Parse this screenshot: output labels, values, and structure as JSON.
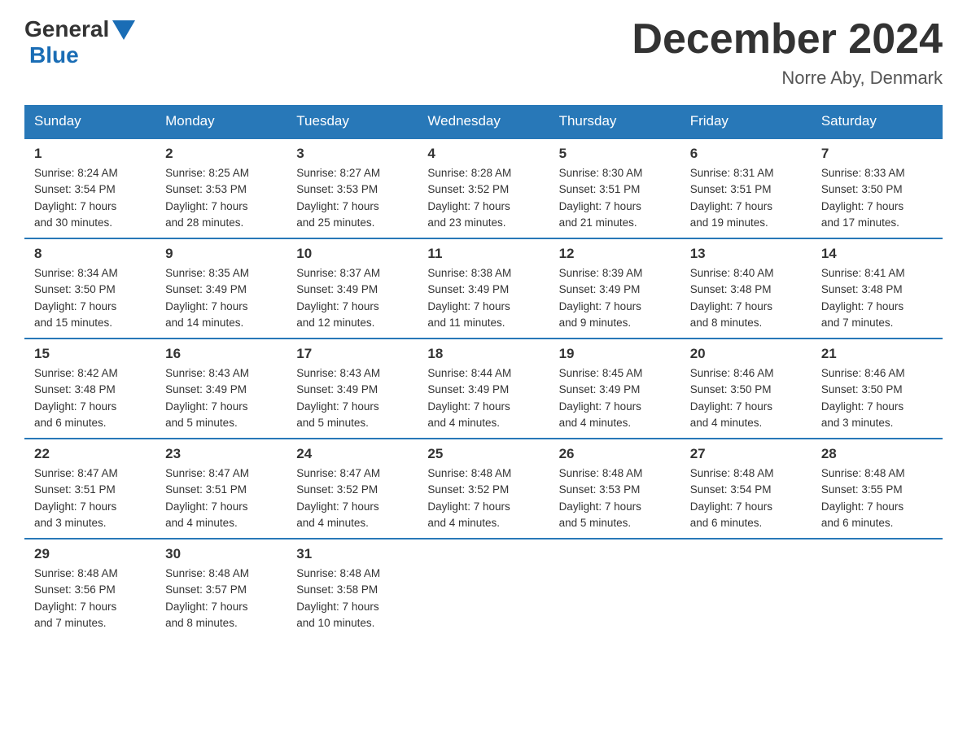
{
  "header": {
    "logo_general": "General",
    "logo_blue": "Blue",
    "title": "December 2024",
    "subtitle": "Norre Aby, Denmark"
  },
  "weekdays": [
    "Sunday",
    "Monday",
    "Tuesday",
    "Wednesday",
    "Thursday",
    "Friday",
    "Saturday"
  ],
  "weeks": [
    [
      {
        "day": "1",
        "info": "Sunrise: 8:24 AM\nSunset: 3:54 PM\nDaylight: 7 hours\nand 30 minutes."
      },
      {
        "day": "2",
        "info": "Sunrise: 8:25 AM\nSunset: 3:53 PM\nDaylight: 7 hours\nand 28 minutes."
      },
      {
        "day": "3",
        "info": "Sunrise: 8:27 AM\nSunset: 3:53 PM\nDaylight: 7 hours\nand 25 minutes."
      },
      {
        "day": "4",
        "info": "Sunrise: 8:28 AM\nSunset: 3:52 PM\nDaylight: 7 hours\nand 23 minutes."
      },
      {
        "day": "5",
        "info": "Sunrise: 8:30 AM\nSunset: 3:51 PM\nDaylight: 7 hours\nand 21 minutes."
      },
      {
        "day": "6",
        "info": "Sunrise: 8:31 AM\nSunset: 3:51 PM\nDaylight: 7 hours\nand 19 minutes."
      },
      {
        "day": "7",
        "info": "Sunrise: 8:33 AM\nSunset: 3:50 PM\nDaylight: 7 hours\nand 17 minutes."
      }
    ],
    [
      {
        "day": "8",
        "info": "Sunrise: 8:34 AM\nSunset: 3:50 PM\nDaylight: 7 hours\nand 15 minutes."
      },
      {
        "day": "9",
        "info": "Sunrise: 8:35 AM\nSunset: 3:49 PM\nDaylight: 7 hours\nand 14 minutes."
      },
      {
        "day": "10",
        "info": "Sunrise: 8:37 AM\nSunset: 3:49 PM\nDaylight: 7 hours\nand 12 minutes."
      },
      {
        "day": "11",
        "info": "Sunrise: 8:38 AM\nSunset: 3:49 PM\nDaylight: 7 hours\nand 11 minutes."
      },
      {
        "day": "12",
        "info": "Sunrise: 8:39 AM\nSunset: 3:49 PM\nDaylight: 7 hours\nand 9 minutes."
      },
      {
        "day": "13",
        "info": "Sunrise: 8:40 AM\nSunset: 3:48 PM\nDaylight: 7 hours\nand 8 minutes."
      },
      {
        "day": "14",
        "info": "Sunrise: 8:41 AM\nSunset: 3:48 PM\nDaylight: 7 hours\nand 7 minutes."
      }
    ],
    [
      {
        "day": "15",
        "info": "Sunrise: 8:42 AM\nSunset: 3:48 PM\nDaylight: 7 hours\nand 6 minutes."
      },
      {
        "day": "16",
        "info": "Sunrise: 8:43 AM\nSunset: 3:49 PM\nDaylight: 7 hours\nand 5 minutes."
      },
      {
        "day": "17",
        "info": "Sunrise: 8:43 AM\nSunset: 3:49 PM\nDaylight: 7 hours\nand 5 minutes."
      },
      {
        "day": "18",
        "info": "Sunrise: 8:44 AM\nSunset: 3:49 PM\nDaylight: 7 hours\nand 4 minutes."
      },
      {
        "day": "19",
        "info": "Sunrise: 8:45 AM\nSunset: 3:49 PM\nDaylight: 7 hours\nand 4 minutes."
      },
      {
        "day": "20",
        "info": "Sunrise: 8:46 AM\nSunset: 3:50 PM\nDaylight: 7 hours\nand 4 minutes."
      },
      {
        "day": "21",
        "info": "Sunrise: 8:46 AM\nSunset: 3:50 PM\nDaylight: 7 hours\nand 3 minutes."
      }
    ],
    [
      {
        "day": "22",
        "info": "Sunrise: 8:47 AM\nSunset: 3:51 PM\nDaylight: 7 hours\nand 3 minutes."
      },
      {
        "day": "23",
        "info": "Sunrise: 8:47 AM\nSunset: 3:51 PM\nDaylight: 7 hours\nand 4 minutes."
      },
      {
        "day": "24",
        "info": "Sunrise: 8:47 AM\nSunset: 3:52 PM\nDaylight: 7 hours\nand 4 minutes."
      },
      {
        "day": "25",
        "info": "Sunrise: 8:48 AM\nSunset: 3:52 PM\nDaylight: 7 hours\nand 4 minutes."
      },
      {
        "day": "26",
        "info": "Sunrise: 8:48 AM\nSunset: 3:53 PM\nDaylight: 7 hours\nand 5 minutes."
      },
      {
        "day": "27",
        "info": "Sunrise: 8:48 AM\nSunset: 3:54 PM\nDaylight: 7 hours\nand 6 minutes."
      },
      {
        "day": "28",
        "info": "Sunrise: 8:48 AM\nSunset: 3:55 PM\nDaylight: 7 hours\nand 6 minutes."
      }
    ],
    [
      {
        "day": "29",
        "info": "Sunrise: 8:48 AM\nSunset: 3:56 PM\nDaylight: 7 hours\nand 7 minutes."
      },
      {
        "day": "30",
        "info": "Sunrise: 8:48 AM\nSunset: 3:57 PM\nDaylight: 7 hours\nand 8 minutes."
      },
      {
        "day": "31",
        "info": "Sunrise: 8:48 AM\nSunset: 3:58 PM\nDaylight: 7 hours\nand 10 minutes."
      },
      {
        "day": "",
        "info": ""
      },
      {
        "day": "",
        "info": ""
      },
      {
        "day": "",
        "info": ""
      },
      {
        "day": "",
        "info": ""
      }
    ]
  ]
}
